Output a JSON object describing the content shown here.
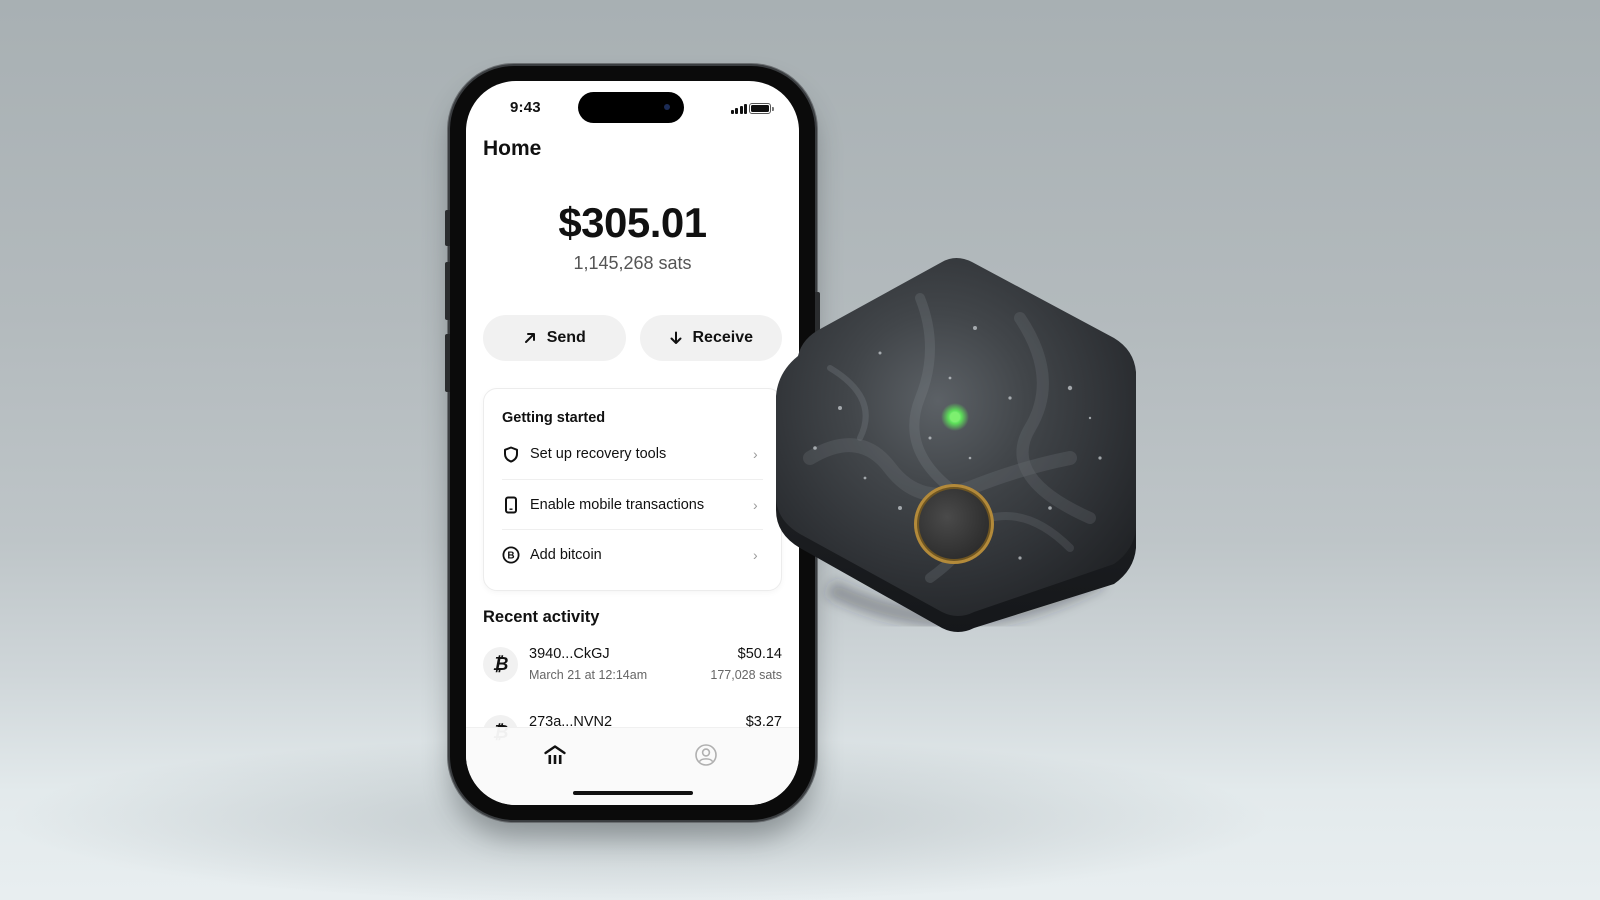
{
  "status_bar": {
    "time": "9:43",
    "signal_icon": "cellular-signal-icon",
    "battery_icon": "battery-icon"
  },
  "home": {
    "title": "Home",
    "balance_usd": "$305.01",
    "balance_sats": "1,145,268 sats"
  },
  "actions": {
    "send": {
      "label": "Send",
      "icon": "arrow-up-right-icon"
    },
    "receive": {
      "label": "Receive",
      "icon": "arrow-down-icon"
    }
  },
  "getting_started": {
    "title": "Getting started",
    "items": [
      {
        "label": "Set up recovery tools",
        "icon": "shield-icon"
      },
      {
        "label": "Enable mobile transactions",
        "icon": "phone-icon"
      },
      {
        "label": "Add bitcoin",
        "icon": "bitcoin-circle-icon"
      }
    ]
  },
  "recent_activity": {
    "title": "Recent activity",
    "transactions": [
      {
        "address": "3940...CkGJ",
        "date": "March 21 at 12:14am",
        "amount": "$50.14",
        "sats": "177,028 sats",
        "icon": "bitcoin-icon"
      },
      {
        "address": "273a...NVN2",
        "date": "",
        "amount": "$3.27",
        "sats": "",
        "icon": "bitcoin-icon"
      }
    ]
  },
  "tab_bar": {
    "tabs": [
      {
        "name": "home",
        "icon": "bank-icon",
        "active": true
      },
      {
        "name": "profile",
        "icon": "user-circle-icon",
        "active": false
      }
    ]
  },
  "device": {
    "led_color": "#5ee35a",
    "ring_color": "#b38a3a"
  }
}
